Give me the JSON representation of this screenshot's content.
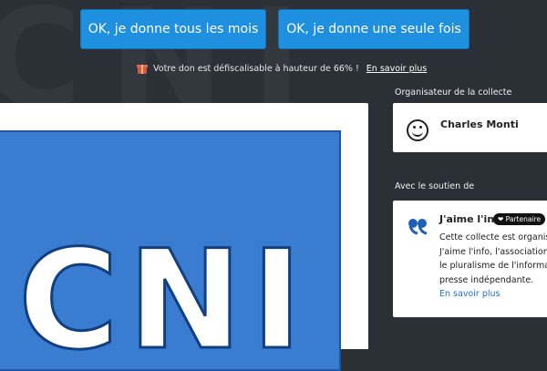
{
  "background_text": "CNI",
  "cta": {
    "monthly_label": "OK, je donne tous les mois",
    "once_label": "OK, je donne une seule fois"
  },
  "tax_note": {
    "text": "Votre don est défiscalisable à hauteur de 66% !",
    "link": "En savoir plus"
  },
  "organizer": {
    "heading": "Organisateur de la collecte",
    "name": "Charles Monti"
  },
  "cover": {
    "text": "CNI"
  },
  "support": {
    "heading": "Avec le soutien de",
    "partner_name": "J'aime l'info",
    "badge": "❤ Partenaire",
    "desc_lines": [
      "Cette collecte est organisé",
      "J'aime l'info, l'association q",
      "le pluralisme de l'informati",
      "presse indépendante."
    ],
    "link": "En savoir plus"
  },
  "colors": {
    "cta_blue": "#1f8fe0",
    "page_dark": "#2b2f36",
    "link_blue": "#1f6fd0",
    "cover_blue": "#3a7ccf"
  }
}
